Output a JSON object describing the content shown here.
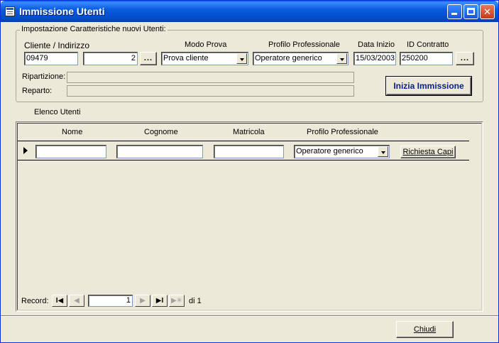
{
  "window": {
    "title": "Immissione Utenti"
  },
  "settings": {
    "legend": "Impostazione Caratteristiche nuovi Utenti:",
    "cliente_label": "Cliente / Indirizzo",
    "cliente_value": "09479",
    "indirizzo_value": "2",
    "browse_label": "...",
    "modo_label": "Modo Prova",
    "modo_value": "Prova cliente",
    "profilo_label": "Profilo Professionale",
    "profilo_value": "Operatore generico",
    "data_label": "Data Inizio",
    "data_value": "15/03/2003",
    "contratto_label": "ID Contratto",
    "contratto_value": "250200",
    "ripartizione_label": "Ripartizione:",
    "reparto_label": "Reparto:",
    "start_button": "Inizia Immissione"
  },
  "list": {
    "title": "Elenco Utenti",
    "columns": [
      "Nome",
      "Cognome",
      "Matricola",
      "Profilo Professionale"
    ],
    "row": {
      "profilo": "Operatore generico",
      "action": "Richiesta Capi"
    }
  },
  "navigator": {
    "label": "Record:",
    "current": "1",
    "total": "di 1"
  },
  "footer": {
    "close_button": "Chiudi"
  }
}
